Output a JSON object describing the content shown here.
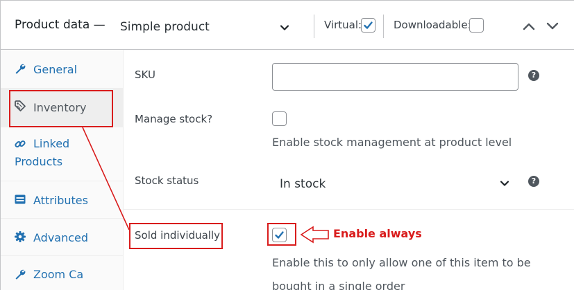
{
  "header": {
    "title": "Product data —",
    "product_type": "Simple product",
    "virtual_label": "Virtual:",
    "virtual_checked": true,
    "downloadable_label": "Downloadable:",
    "downloadable_checked": false
  },
  "tabs": [
    {
      "label": "General",
      "icon": "wrench-icon",
      "active": false
    },
    {
      "label": "Inventory",
      "icon": "tag-icon",
      "active": true
    },
    {
      "label": "Linked Products",
      "icon": "link-icon",
      "active": false
    },
    {
      "label": "Attributes",
      "icon": "table-icon",
      "active": false
    },
    {
      "label": "Advanced",
      "icon": "gear-icon",
      "active": false
    },
    {
      "label": "Zoom Ca",
      "icon": "wrench-icon",
      "active": false
    }
  ],
  "inventory": {
    "sku_label": "SKU",
    "sku_value": "",
    "manage_stock_label": "Manage stock?",
    "manage_stock_checked": false,
    "manage_stock_desc": "Enable stock management at product level",
    "stock_status_label": "Stock status",
    "stock_status_value": "In stock",
    "sold_individually_label": "Sold individually",
    "sold_individually_checked": true,
    "sold_individually_desc": "Enable this to only allow one of this item to be bought in a single order"
  },
  "annotation": {
    "text": "Enable always",
    "color": "#d91c1c"
  },
  "colors": {
    "link": "#2271b1",
    "checkbox_check": "#2271b1",
    "annotation": "#d91c1c"
  }
}
